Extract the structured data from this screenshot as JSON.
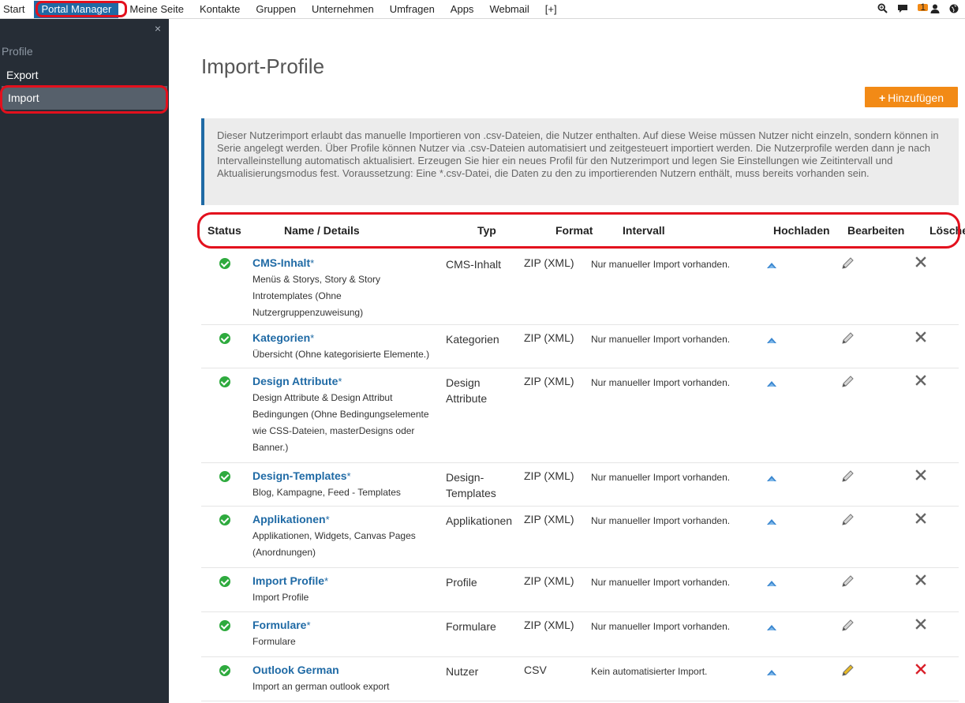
{
  "nav": {
    "items": [
      "Start",
      "Portal Manager",
      "Meine Seite",
      "Kontakte",
      "Gruppen",
      "Unternehmen",
      "Umfragen",
      "Apps",
      "Webmail",
      "[+]"
    ],
    "active": "Portal Manager",
    "notification_count": "1"
  },
  "sidebar": {
    "close": "×",
    "section": "Profile",
    "items": [
      "Export",
      "Import"
    ]
  },
  "main": {
    "title": "Import-Profile",
    "add_label": "Hinzufügen",
    "info": "Dieser Nutzerimport erlaubt das manuelle Importieren von .csv-Dateien, die Nutzer enthalten. Auf diese Weise müssen Nutzer nicht einzeln, sondern können in Serie angelegt werden. Über Profile können Nutzer via .csv-Dateien automatisiert und zeitgesteuert importiert werden. Die Nutzerprofile werden dann je nach Intervalleinstellung automatisch aktualisiert. Erzeugen Sie hier ein neues Profil für den Nutzerimport und legen Sie Einstellungen wie Zeitintervall und Aktualisierungsmodus fest. Voraussetzung: Eine *.csv-Datei, die Daten zu den zu importierenden Nutzern enthält, muss bereits vorhanden sein."
  },
  "table": {
    "headers": [
      "Status",
      "Name / Details",
      "Typ",
      "Format",
      "Intervall",
      "Hochladen",
      "Bearbeiten",
      "Löschen"
    ],
    "rows": [
      {
        "name": "CMS-Inhalt",
        "star": "*",
        "details": "Menüs & Storys, Story & Story Introtemplates (Ohne Nutzergruppenzuweisung)",
        "typ": "CMS-Inhalt",
        "format": "ZIP (XML)",
        "intervall": "Nur manueller Import vorhanden.",
        "custom": false
      },
      {
        "name": "Kategorien",
        "star": "*",
        "details": "Übersicht (Ohne kategorisierte Elemente.)",
        "typ": "Kategorien",
        "format": "ZIP (XML)",
        "intervall": "Nur manueller Import vorhanden.",
        "custom": false
      },
      {
        "name": "Design Attribute",
        "star": "*",
        "details": "Design Attribute & Design Attribut Bedingungen (Ohne Bedingungselemente wie CSS-Dateien, masterDesigns oder Banner.)",
        "typ": "Design Attribute",
        "format": "ZIP (XML)",
        "intervall": "Nur manueller Import vorhanden.",
        "custom": false
      },
      {
        "name": "Design-Templates",
        "star": "*",
        "details": "Blog, Kampagne, Feed - Templates",
        "typ": "Design-Templates",
        "format": "ZIP (XML)",
        "intervall": "Nur manueller Import vorhanden.",
        "custom": false
      },
      {
        "name": "Applikationen",
        "star": "*",
        "details": "Applikationen, Widgets, Canvas Pages (Anordnungen)",
        "typ": "Applikationen",
        "format": "ZIP (XML)",
        "intervall": "Nur manueller Import vorhanden.",
        "custom": false
      },
      {
        "name": "Import Profile",
        "star": "*",
        "details": "Import Profile",
        "typ": "Profile",
        "format": "ZIP (XML)",
        "intervall": "Nur manueller Import vorhanden.",
        "custom": false
      },
      {
        "name": "Formulare",
        "star": "*",
        "details": "Formulare",
        "typ": "Formulare",
        "format": "ZIP (XML)",
        "intervall": "Nur manueller Import vorhanden.",
        "custom": false
      },
      {
        "name": "Outlook German",
        "star": "",
        "details": "Import an german outlook export",
        "typ": "Nutzer",
        "format": "CSV",
        "intervall": "Kein automatisierter Import.",
        "custom": true
      }
    ]
  },
  "colors": {
    "accent": "#1f6aa5",
    "orange": "#f28a16",
    "sidebar_bg": "#262d36",
    "status_ok": "#2eaa3e",
    "highlight": "#e3101d",
    "edit_active": "#e8b923",
    "delete_active": "#d9202a",
    "icon_gray": "#777777"
  },
  "icons": {
    "status": "check-circle-icon",
    "upload": "upload-icon",
    "edit": "pencil-icon",
    "delete": "close-icon"
  }
}
